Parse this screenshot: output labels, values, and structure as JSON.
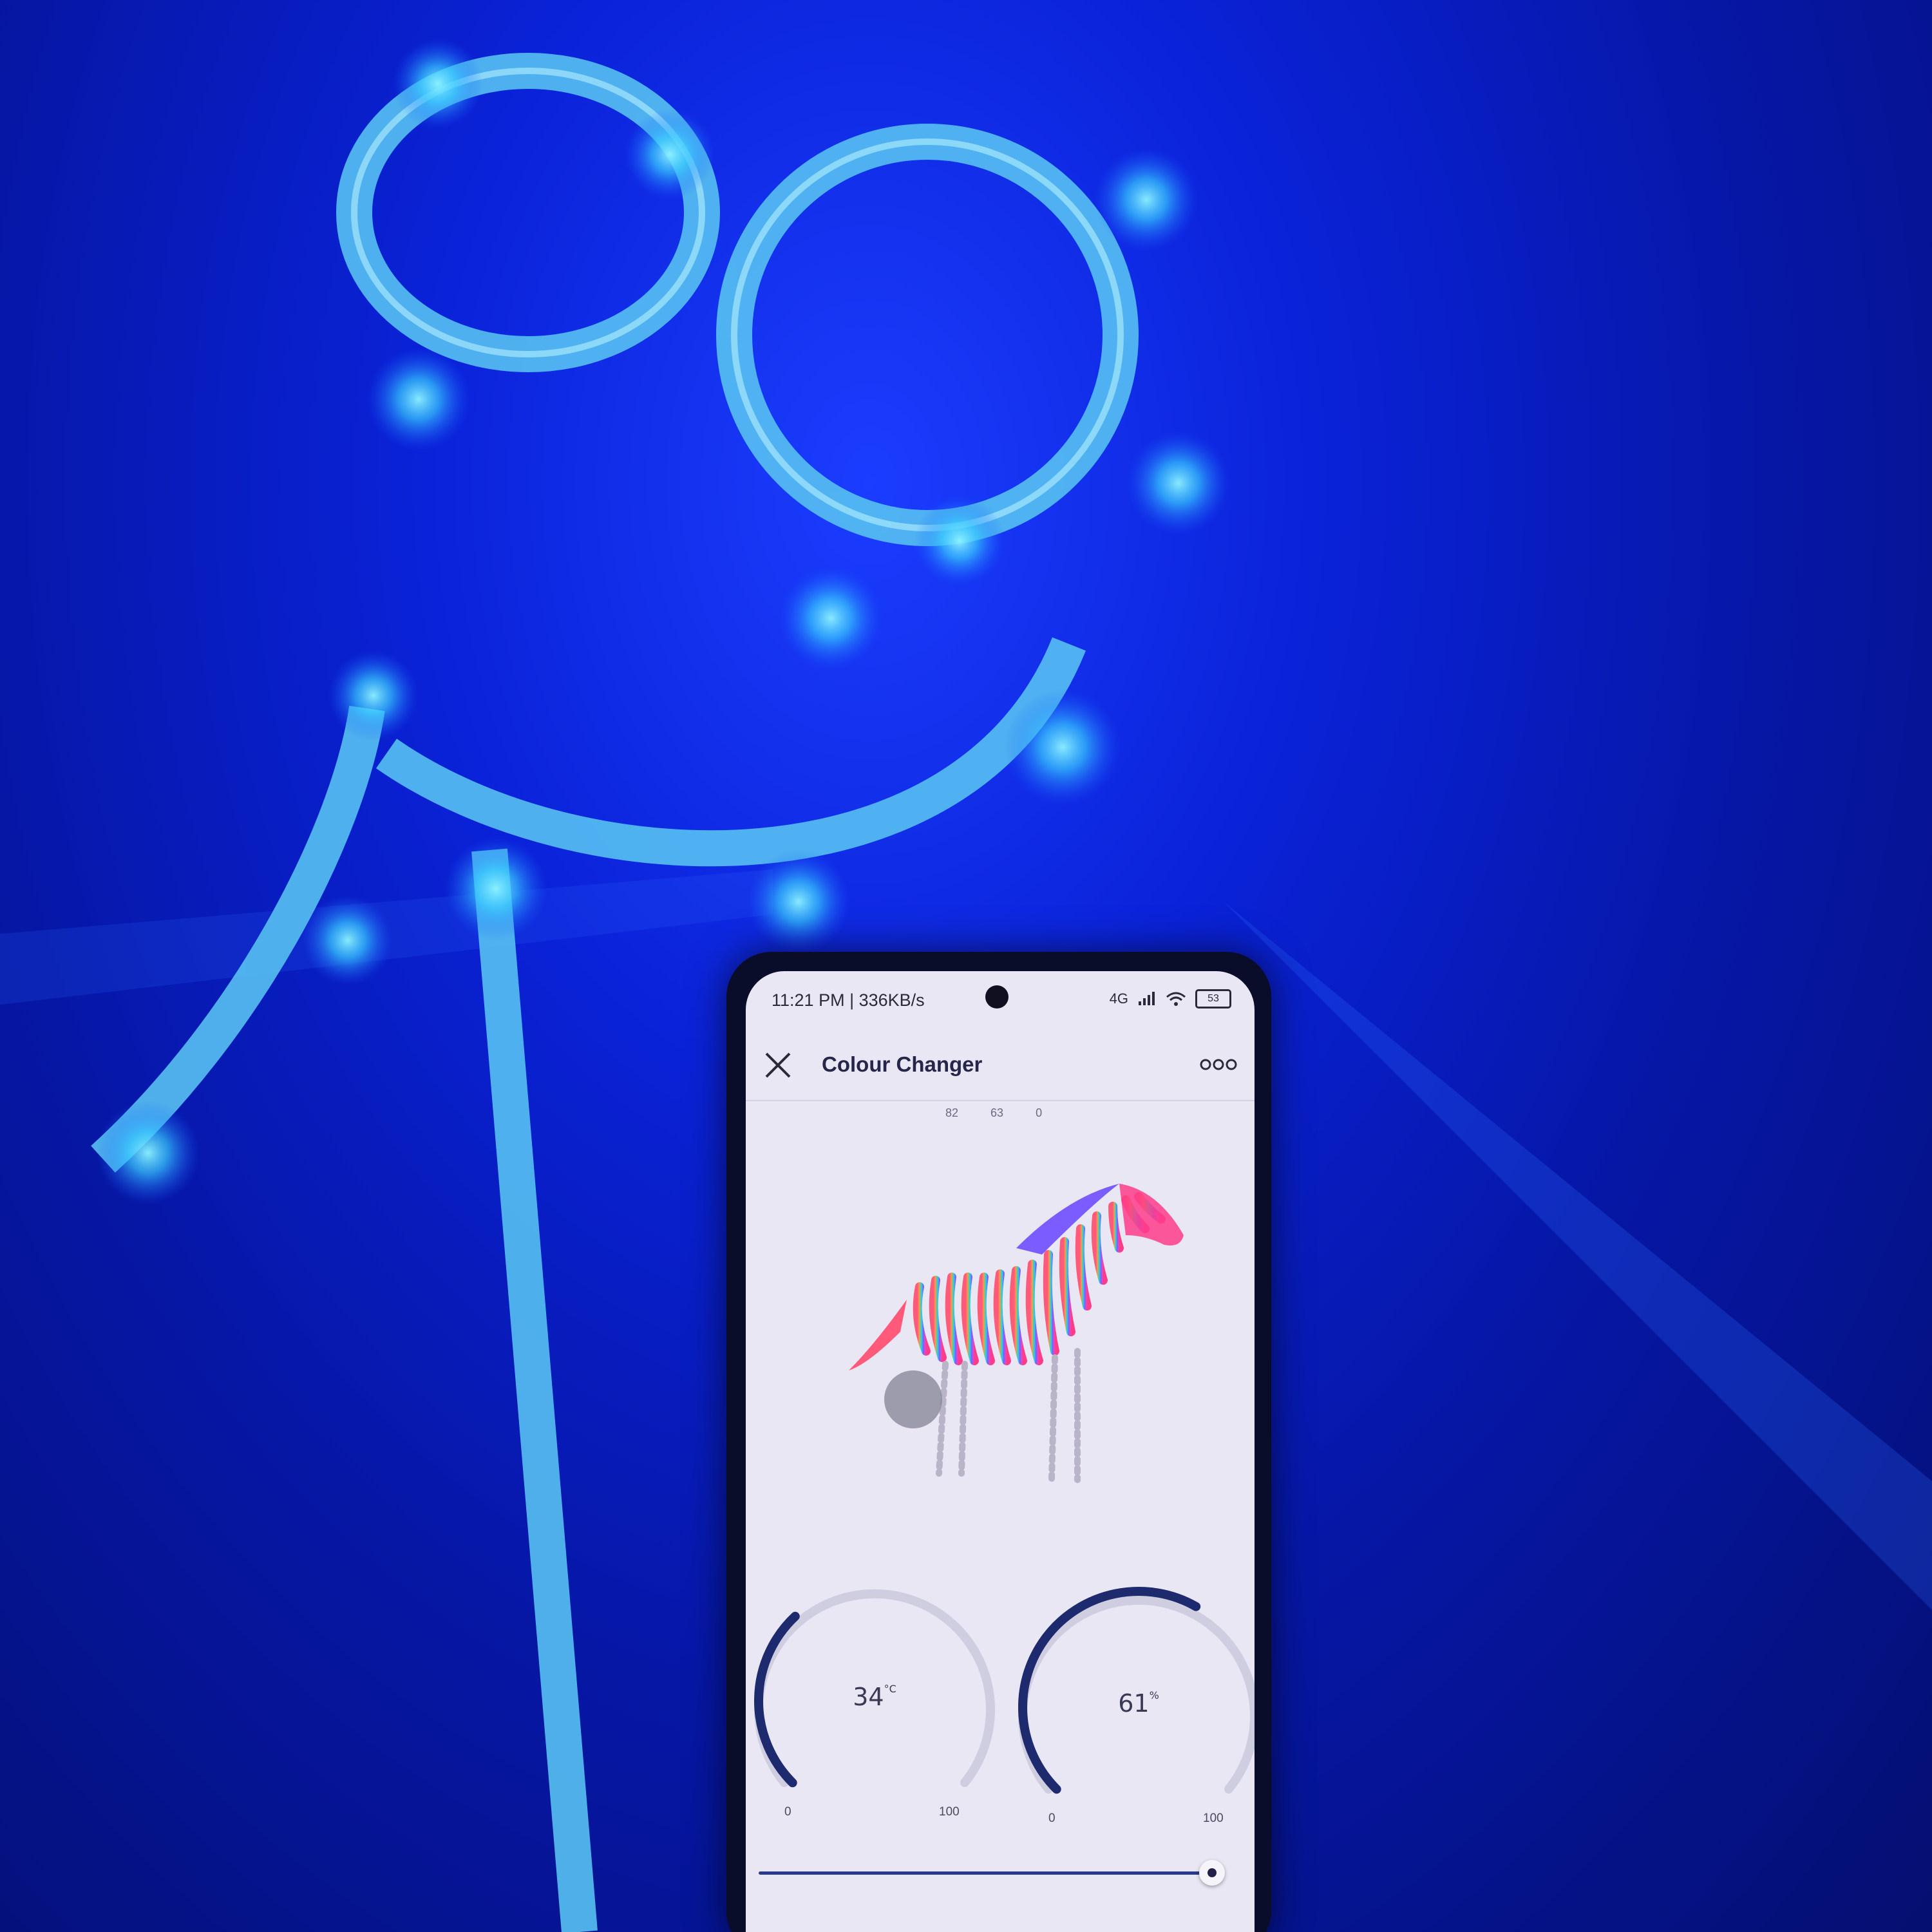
{
  "status_bar": {
    "time_speed": "11:21 PM | 336KB/s",
    "network": "4G",
    "battery": "53"
  },
  "header": {
    "title": "Colour Changer"
  },
  "rgb_readout": [
    "82",
    "63",
    "0"
  ],
  "gauges": [
    {
      "value": "34",
      "unit": "°C",
      "min": "0",
      "max": "100",
      "level": 0.34
    },
    {
      "value": "61",
      "unit": "%",
      "min": "0",
      "max": "100",
      "level": 0.61
    }
  ],
  "brightness_slider": {
    "level": 0.97
  },
  "colors": {
    "led_glow": "#3ad2ff",
    "background_blue": "#0a22d8",
    "gauge_accent": "#1e2a6e",
    "gauge_track": "#cfcde0"
  },
  "icons": [
    "close-icon",
    "more-icon",
    "alarm-icon",
    "wifi-icon",
    "signal-icon",
    "battery-icon"
  ]
}
